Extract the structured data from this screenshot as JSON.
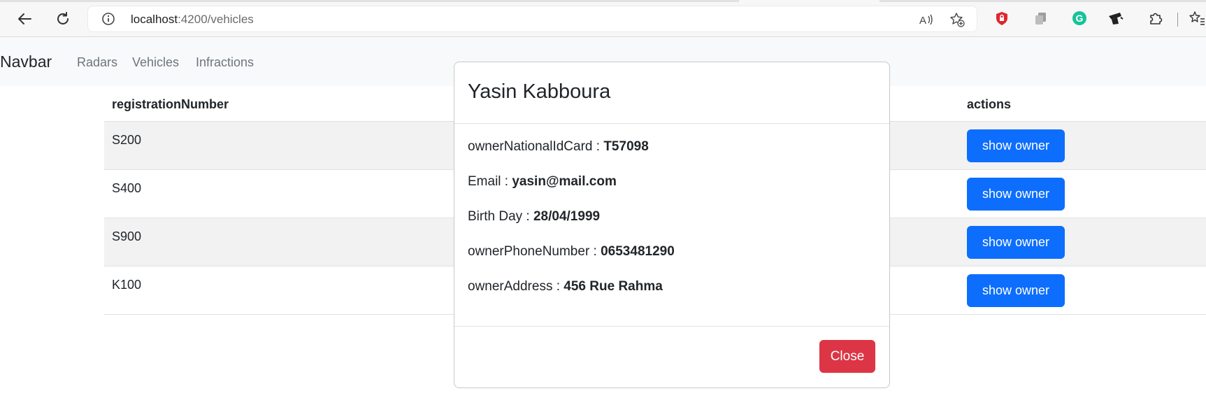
{
  "browser": {
    "url_host": "localhost",
    "url_path": ":4200/vehicles"
  },
  "navbar": {
    "brand": "Navbar",
    "links": [
      "Radars",
      "Vehicles",
      "Infractions"
    ]
  },
  "table": {
    "headers": {
      "registration": "registrationNumber",
      "actions": "actions"
    },
    "rows": [
      {
        "registrationNumber": "S200",
        "action": "show owner"
      },
      {
        "registrationNumber": "S400",
        "action": "show owner"
      },
      {
        "registrationNumber": "S900",
        "action": "show owner"
      },
      {
        "registrationNumber": "K100",
        "action": "show owner"
      }
    ]
  },
  "modal": {
    "title": "Yasin Kabboura",
    "fields": [
      {
        "label": "ownerNationalIdCard : ",
        "value": "T57098"
      },
      {
        "label": "Email : ",
        "value": "yasin@mail.com"
      },
      {
        "label": "Birth Day : ",
        "value": "28/04/1999"
      },
      {
        "label": "ownerPhoneNumber : ",
        "value": "0653481290"
      },
      {
        "label": "ownerAddress : ",
        "value": "456 Rue Rahma"
      }
    ],
    "close_label": "Close"
  },
  "colors": {
    "primary": "#0d6efd",
    "danger": "#dc3545",
    "navbar_bg": "#f8f9fa"
  }
}
